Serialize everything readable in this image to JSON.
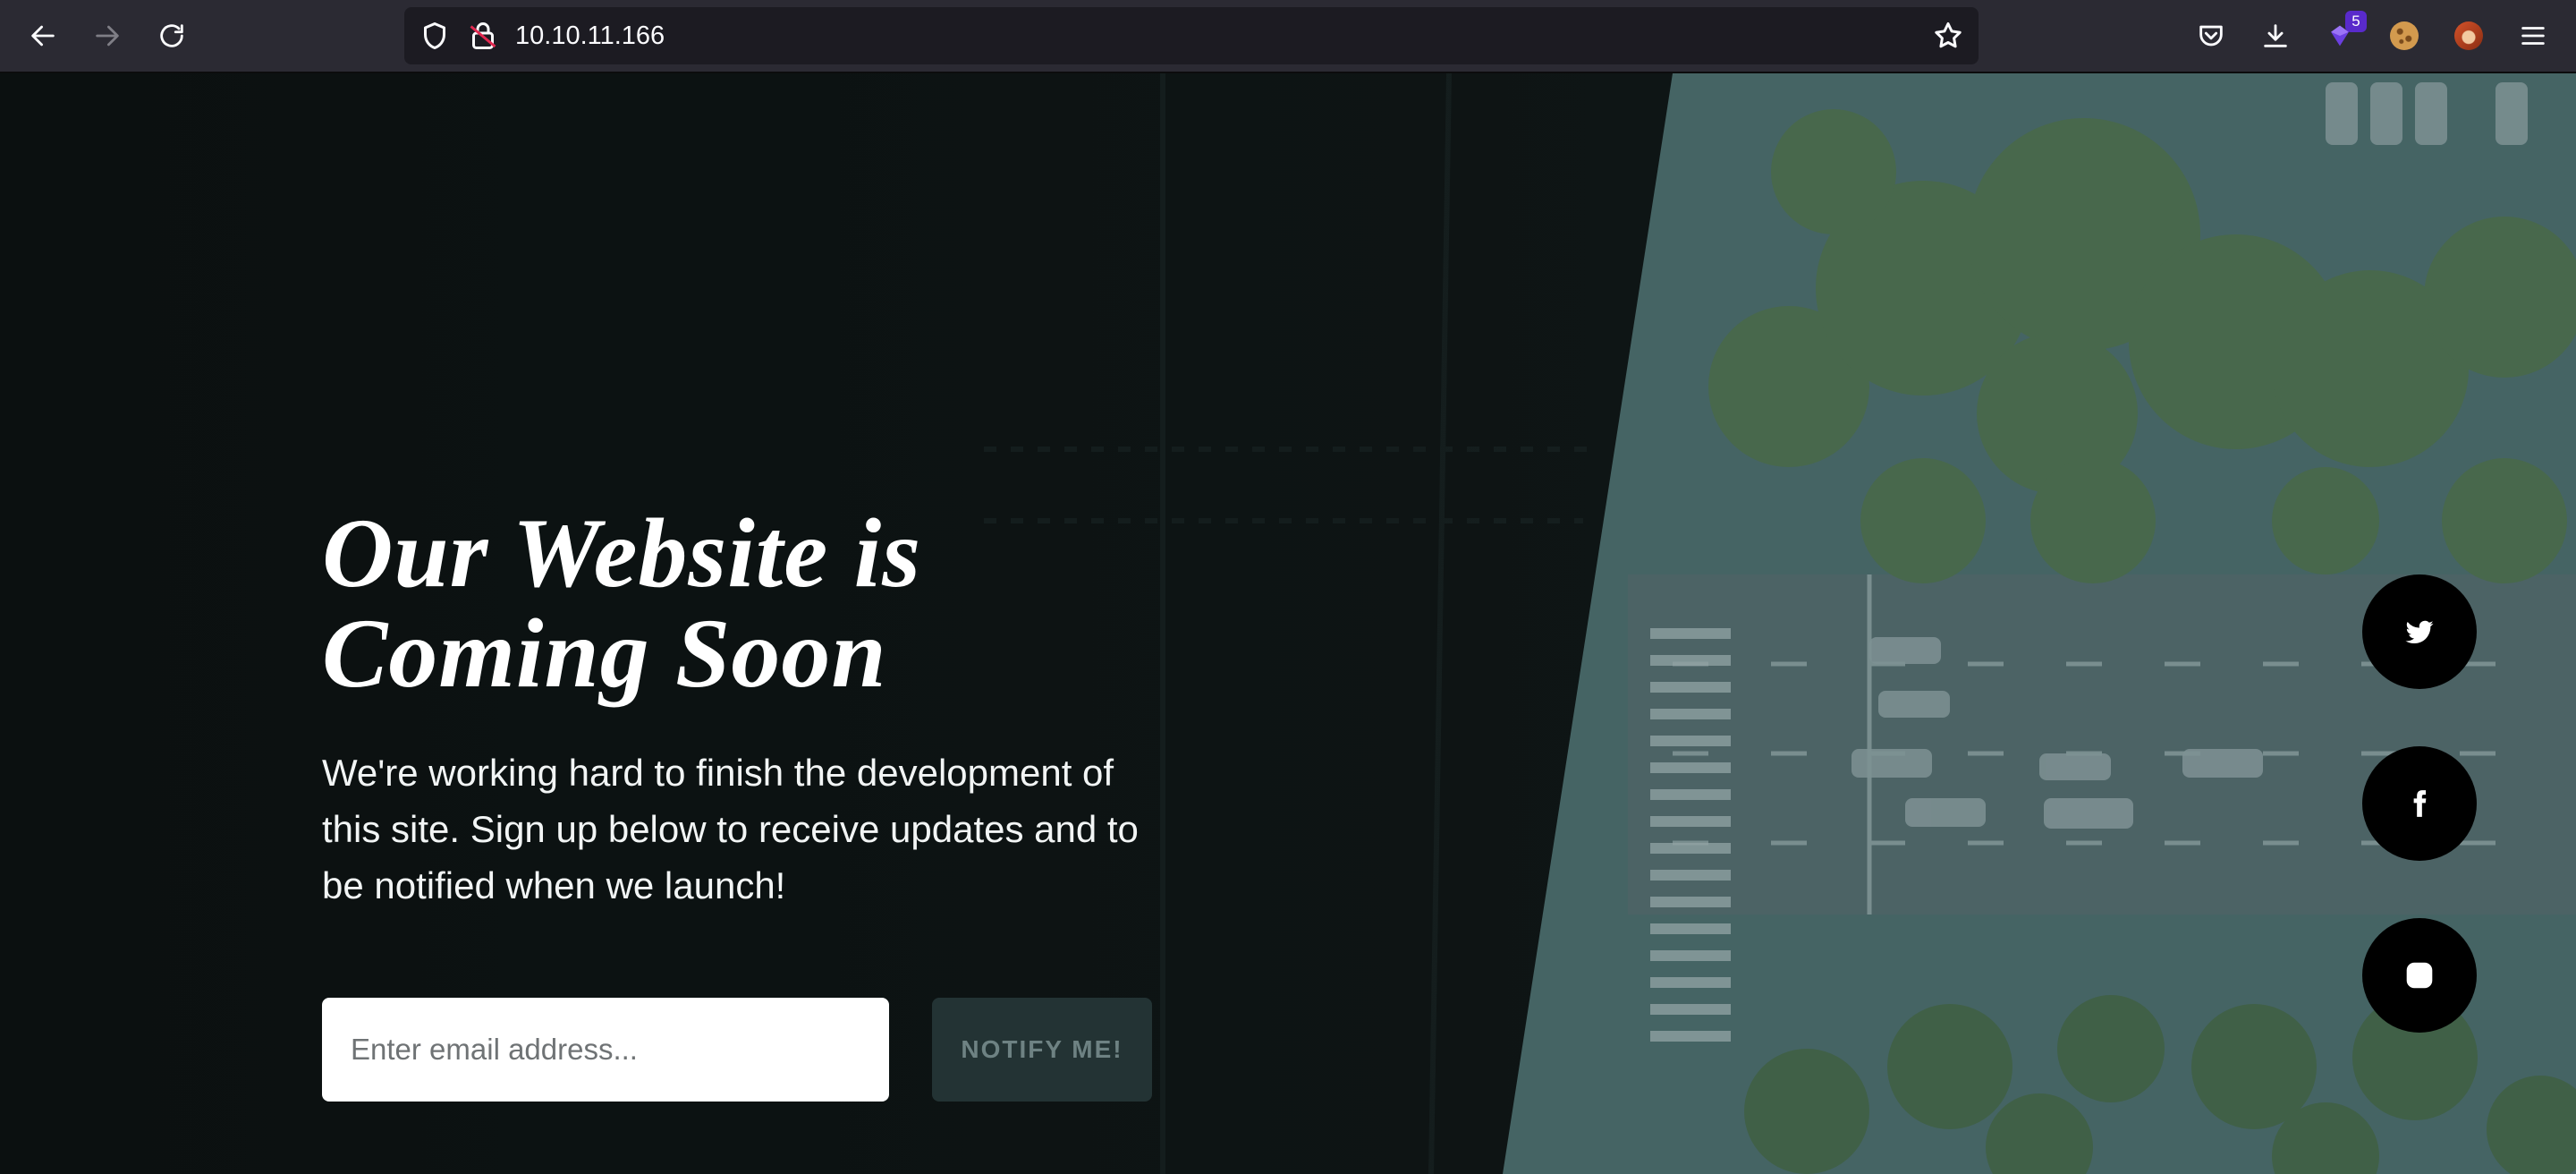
{
  "browser": {
    "url": "10.10.11.166",
    "extension_badge_count": "5",
    "icons": [
      "back-icon",
      "forward-icon",
      "reload-icon",
      "shield-icon",
      "insecure-lock-icon",
      "bookmark-star-icon",
      "pocket-icon",
      "download-icon",
      "extension-icon",
      "cookie-icon",
      "avatar-extension-icon",
      "menu-icon"
    ]
  },
  "hero": {
    "headline_line1": "Our Website is",
    "headline_line2": "Coming Soon",
    "subtext": "We're working hard to finish the development of this site. Sign up below to receive updates and to be notified when we launch!"
  },
  "signup": {
    "email_placeholder": "Enter email address...",
    "email_value": "",
    "notify_label": "NOTIFY ME!"
  },
  "social": [
    "twitter-icon",
    "facebook-icon",
    "instagram-icon"
  ],
  "colors": {
    "overlay_dark": "#0c1212",
    "notify_bg": "#233334",
    "notify_text": "#6e8283",
    "social_bg": "#000000",
    "toolbar_bg": "#2b2a33"
  }
}
